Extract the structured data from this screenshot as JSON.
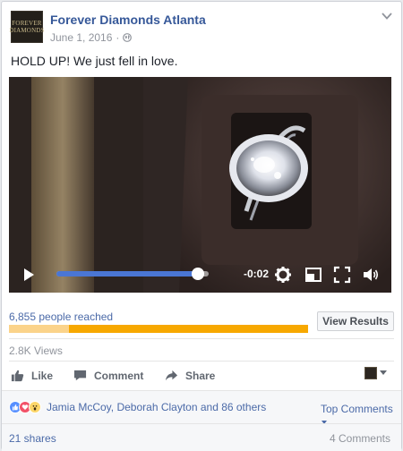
{
  "post": {
    "page_name": "Forever Diamonds Atlanta",
    "date": "June 1, 2016",
    "separator": "·",
    "text": "HOLD UP! We just fell in love.",
    "avatar_line1": "FOREVER",
    "avatar_line2": "DIAMONDS"
  },
  "video": {
    "time_remaining": "-0:02",
    "progress_fraction": 0.93,
    "icons": [
      "play-icon",
      "settings-gear-icon",
      "minimize-window-icon",
      "fullscreen-icon",
      "volume-icon"
    ]
  },
  "reach": {
    "label": "6,855 people reached",
    "organic_fraction": 0.2,
    "button_label": "View Results",
    "colors": {
      "paid": "#f7a800",
      "organic": "#fbd38a"
    }
  },
  "views": "2.8K Views",
  "actions": {
    "like": "Like",
    "comment": "Comment",
    "share": "Share"
  },
  "reactions": {
    "types": [
      "like",
      "love",
      "wow"
    ],
    "text": "Jamia McCoy, Deborah Clayton and 86 others",
    "sort_label": "Top Comments"
  },
  "footer": {
    "shares": "21 shares",
    "comments": "4 Comments"
  },
  "colors": {
    "link": "#365899",
    "meta": "#90949c",
    "like_blue": "#5890ff",
    "love_red": "#f25268",
    "wow_yellow": "#fcd669"
  }
}
